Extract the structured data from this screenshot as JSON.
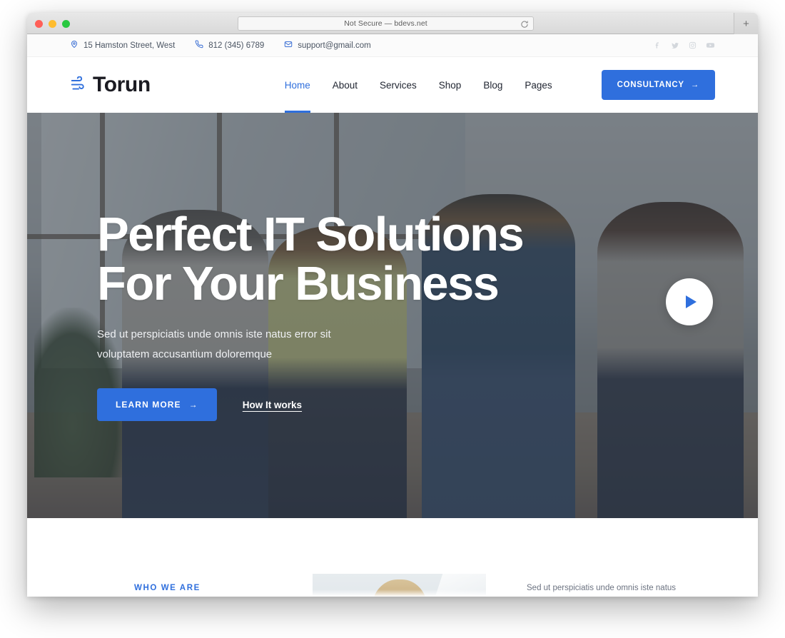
{
  "browser": {
    "url_text": "Not Secure — bdevs.net",
    "reload_title": "Reload",
    "new_tab_label": "+"
  },
  "topbar": {
    "address": "15 Hamston Street, West",
    "phone": "812 (345) 6789",
    "email": "support@gmail.com",
    "socials": [
      "facebook",
      "twitter",
      "instagram",
      "youtube"
    ]
  },
  "header": {
    "logo_text": "Torun",
    "nav": [
      {
        "label": "Home",
        "active": true
      },
      {
        "label": "About",
        "active": false
      },
      {
        "label": "Services",
        "active": false
      },
      {
        "label": "Shop",
        "active": false
      },
      {
        "label": "Blog",
        "active": false
      },
      {
        "label": "Pages",
        "active": false
      }
    ],
    "cta_label": "CONSULTANCY",
    "cta_arrow": "→"
  },
  "hero": {
    "title_line1": "Perfect IT Solutions",
    "title_line2": "For Your Business",
    "subtitle_line1": "Sed ut perspiciatis unde omnis iste natus error sit",
    "subtitle_line2": "voluptatem accusantium doloremque",
    "primary_button": "LEARN MORE",
    "primary_arrow": "→",
    "secondary_link": "How It works",
    "play_button_label": "Play video"
  },
  "next_section": {
    "eyebrow": "WHO WE ARE",
    "right_text": "Sed ut perspiciatis unde omnis iste natus"
  },
  "colors": {
    "accent": "#2f6fdd",
    "text_dark": "#1f2430",
    "text_muted": "#6b7280",
    "topbar_bg": "#fbfbfb",
    "social_icon": "#d3d7dc"
  }
}
